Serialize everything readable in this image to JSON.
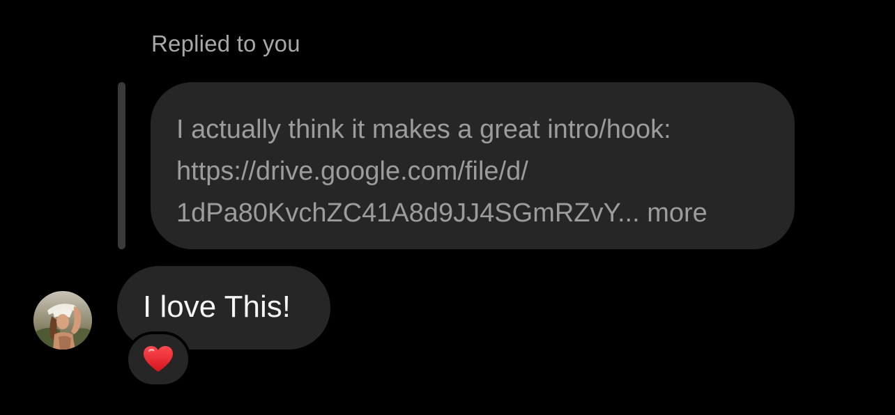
{
  "reply": {
    "header": "Replied to you",
    "quoted_lines": [
      "I actually think it makes a great intro/hook:",
      "https://drive.google.com/file/d/",
      "1dPa80KvchZC41A8d9JJ4SGmRZvY..."
    ],
    "more_label": "more"
  },
  "message": {
    "text": "I love This!",
    "avatar_icon": "user-avatar-photo",
    "reaction_icon": "red-heart-icon",
    "reaction_color": "#e0202e"
  },
  "colors": {
    "background": "#000000",
    "bubble": "#262626",
    "quoted_text": "#9c9c9c",
    "message_text": "#f5f5f5"
  }
}
